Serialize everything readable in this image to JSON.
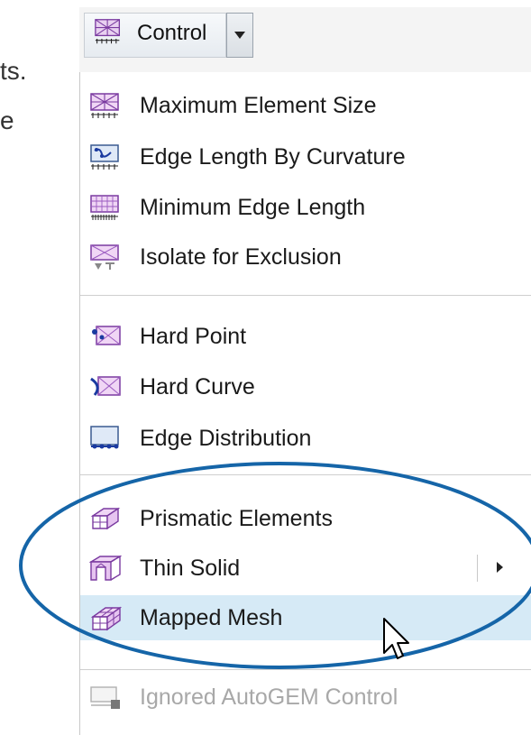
{
  "background": {
    "fragment_1": "ts.",
    "fragment_2": "e"
  },
  "toolbar": {
    "control_label": "Control"
  },
  "menu": {
    "group1": [
      {
        "label": "Maximum Element Size",
        "icon": "max-element-size-icon"
      },
      {
        "label": "Edge Length By Curvature",
        "icon": "edge-length-curvature-icon"
      },
      {
        "label": "Minimum Edge Length",
        "icon": "min-edge-length-icon"
      },
      {
        "label": "Isolate for Exclusion",
        "icon": "isolate-exclusion-icon"
      }
    ],
    "group2": [
      {
        "label": "Hard Point",
        "icon": "hard-point-icon"
      },
      {
        "label": "Hard Curve",
        "icon": "hard-curve-icon"
      },
      {
        "label": "Edge Distribution",
        "icon": "edge-distribution-icon"
      }
    ],
    "group3": [
      {
        "label": "Prismatic Elements",
        "icon": "prismatic-elements-icon"
      },
      {
        "label": "Thin Solid",
        "icon": "thin-solid-icon",
        "has_submenu": true
      },
      {
        "label": "Mapped Mesh",
        "icon": "mapped-mesh-icon",
        "hovered": true
      }
    ],
    "group4": [
      {
        "label": "Ignored AutoGEM Control",
        "icon": "ignored-autogem-icon",
        "disabled": true
      }
    ]
  },
  "colors": {
    "highlight_ellipse": "#1565a8",
    "hover_background": "#d6eaf6",
    "disabled_text": "#a8a8a8"
  }
}
